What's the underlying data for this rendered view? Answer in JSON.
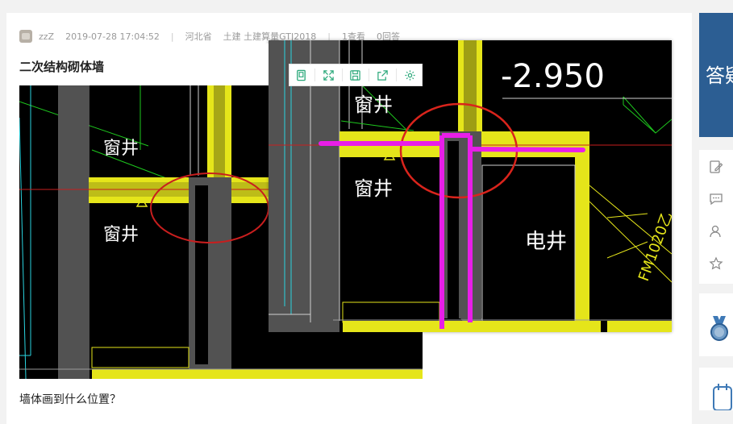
{
  "post": {
    "author": "zzZ",
    "datetime": "2019-07-28 17:04:52",
    "region": "河北省",
    "category": "土建 土建算量GTJ2018",
    "views": "1查看",
    "answers": "0回答",
    "separator": "|",
    "title": "二次结构砌体墙",
    "question": "墙体画到什么位置？"
  },
  "cad_small": {
    "labels": [
      "窗井",
      "窗井"
    ]
  },
  "cad_zoom": {
    "elevation": "-2.950",
    "labels": [
      "窗井",
      "窗井",
      "电井",
      "FM1020乙"
    ]
  },
  "toolbar": {
    "icons": [
      "page-icon",
      "fullscreen-icon",
      "save-icon",
      "share-icon",
      "settings-icon"
    ]
  },
  "sidebar": {
    "banner_text": "答疑"
  },
  "colors": {
    "cad_bg": "#000000",
    "wall_yellow": "#e5e51a",
    "wall_gray": "#525252",
    "annotation_red": "#d9241c",
    "annotation_magenta": "#e81ee8",
    "banner_blue": "#2c5e93"
  }
}
